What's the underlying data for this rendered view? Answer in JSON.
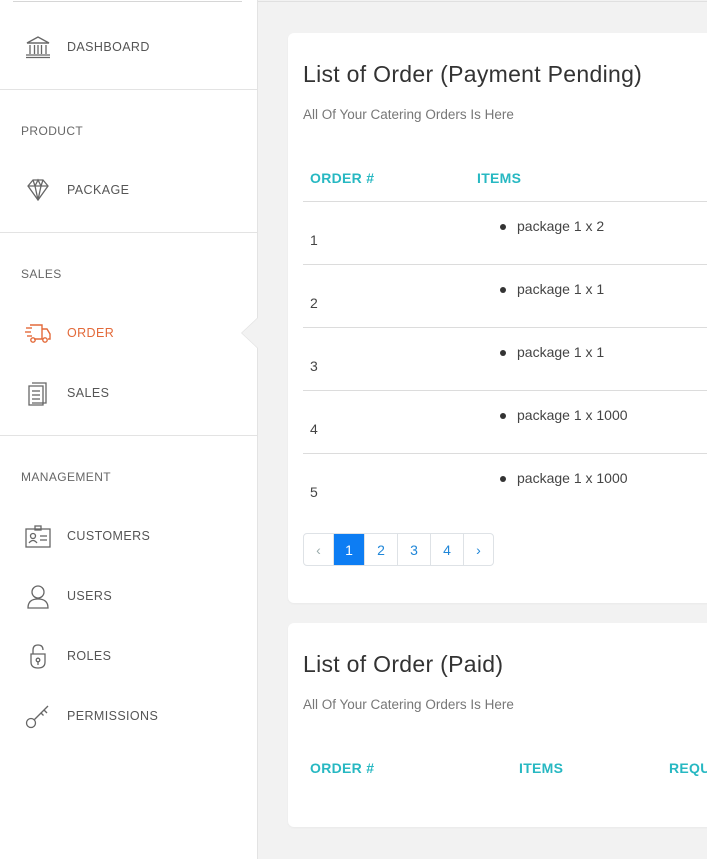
{
  "sidebar": {
    "dashboard": "DASHBOARD",
    "section_product": "PRODUCT",
    "package": "PACKAGE",
    "section_sales": "SALES",
    "order": "ORDER",
    "sales": "SALES",
    "section_management": "MANAGEMENT",
    "customers": "CUSTOMERS",
    "users": "USERS",
    "roles": "ROLES",
    "permissions": "PERMISSIONS",
    "active_color": "#e36a3a"
  },
  "pending_card": {
    "title": "List of Order (Payment Pending)",
    "subtitle": "All Of Your Catering Orders Is Here",
    "col_order": "ORDER #",
    "col_items": "ITEMS",
    "rows": [
      {
        "order": "1",
        "item": "package 1 x 2"
      },
      {
        "order": "2",
        "item": "package 1 x 1"
      },
      {
        "order": "3",
        "item": "package 1 x 1"
      },
      {
        "order": "4",
        "item": "package 1 x 1000"
      },
      {
        "order": "5",
        "item": "package 1 x 1000"
      }
    ],
    "pagination": {
      "prev": "‹",
      "pages": [
        "1",
        "2",
        "3",
        "4"
      ],
      "next": "›",
      "current": "1"
    }
  },
  "paid_card": {
    "title": "List of Order (Paid)",
    "subtitle": "All Of Your Catering Orders Is Here",
    "col_order": "ORDER #",
    "col_items": "ITEMS",
    "col_request": "REQU"
  },
  "colors": {
    "header_accent": "#27b8c2",
    "page_active": "#0d7df3"
  }
}
